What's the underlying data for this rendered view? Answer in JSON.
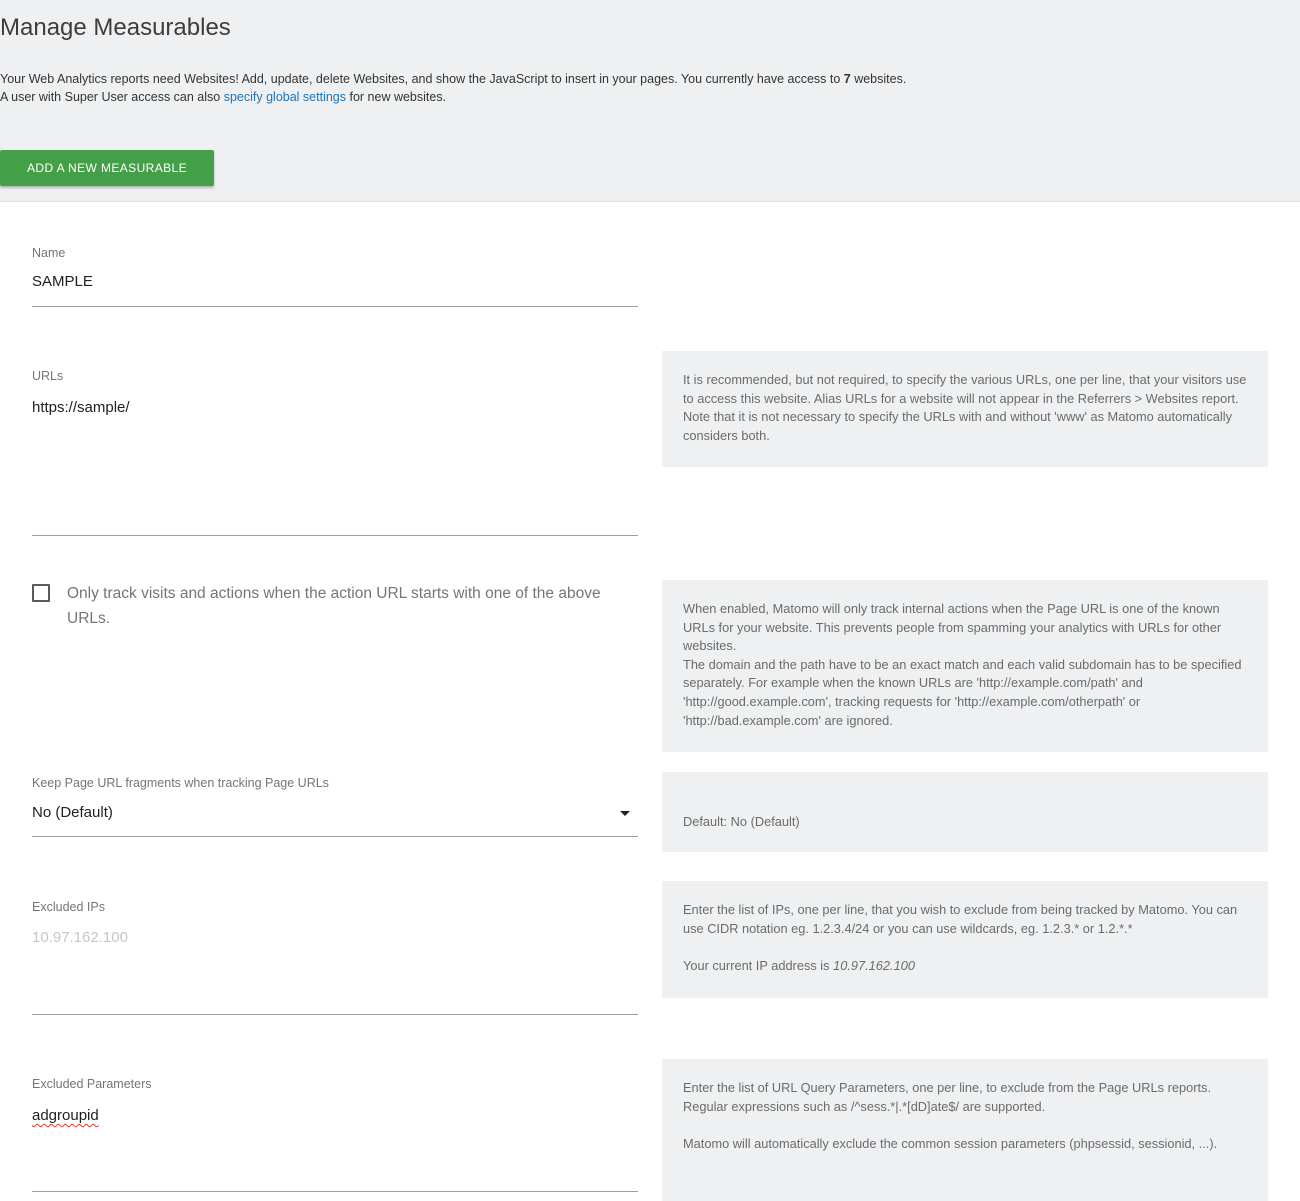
{
  "header": {
    "title": "Manage Measurables",
    "intro_line1_part1": "Your Web Analytics reports need Websites! Add, update, delete Websites, and show the JavaScript to insert in your pages. You currently have access to ",
    "site_count": "7",
    "intro_line1_part2": " websites.",
    "intro_line2_part1": "A user with Super User access can also ",
    "global_settings_link": "specify global settings",
    "intro_line2_part2": " for new websites.",
    "add_button_label": "Add a new measurable"
  },
  "form": {
    "name": {
      "label": "Name",
      "value": "SAMPLE"
    },
    "urls": {
      "label": "URLs",
      "value": "https://sample/",
      "help": "It is recommended, but not required, to specify the various URLs, one per line, that your visitors use to access this website. Alias URLs for a website will not appear in the Referrers > Websites report. Note that it is not necessary to specify the URLs with and without 'www' as Matomo automatically considers both."
    },
    "only_track_known_urls": {
      "label": "Only track visits and actions when the action URL starts with one of the above URLs.",
      "checked": false,
      "help_part1": "When enabled, Matomo will only track internal actions when the Page URL is one of the known URLs for your website. This prevents people from spamming your analytics with URLs for other websites.",
      "help_part2": "The domain and the path have to be an exact match and each valid subdomain has to be specified separately. For example when the known URLs are 'http://example.com/path' and 'http://good.example.com', tracking requests for 'http://example.com/otherpath' or 'http://bad.example.com' are ignored."
    },
    "keep_url_fragments": {
      "label": "Keep Page URL fragments when tracking Page URLs",
      "selected": "No (Default)",
      "help": "Default: No (Default)"
    },
    "excluded_ips": {
      "label": "Excluded IPs",
      "placeholder": "10.97.162.100",
      "help_part1": "Enter the list of IPs, one per line, that you wish to exclude from being tracked by Matomo. You can use CIDR notation eg. 1.2.3.4/24 or you can use wildcards, eg. 1.2.3.* or 1.2.*.*",
      "help_current_ip_prefix": "Your current IP address is ",
      "help_current_ip": "10.97.162.100"
    },
    "excluded_parameters": {
      "label": "Excluded Parameters",
      "value": "adgroupid",
      "help_part1": "Enter the list of URL Query Parameters, one per line, to exclude from the Page URLs reports. Regular expressions such as /^sess.*|.*[dD]ate$/ are supported.",
      "help_part2": "Matomo will automatically exclude the common session parameters (phpsessid, sessionid, ...)."
    }
  },
  "colors": {
    "header_bg": "#eef0f2",
    "primary_button": "#43a047",
    "link": "#1f73b7"
  }
}
